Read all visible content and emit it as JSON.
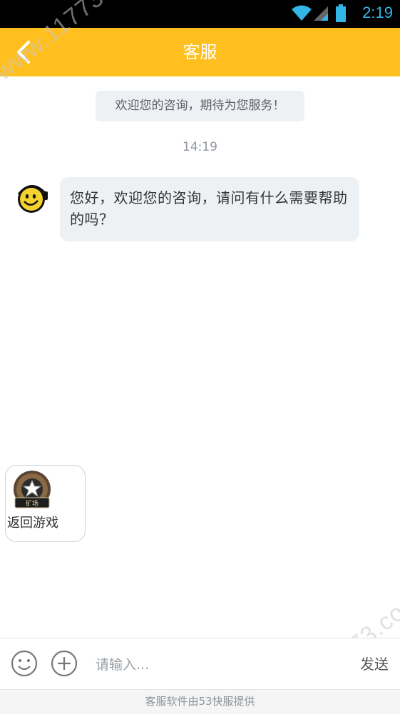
{
  "status_bar": {
    "time": "2:19"
  },
  "header": {
    "title": "客服"
  },
  "watermark": {
    "text": "www.11773.com"
  },
  "chat": {
    "welcome": "欢迎您的咨询，期待为您服务！",
    "timestamp": "14:19",
    "agent_message": "您好，欢迎您的咨询，请问有什么需要帮助的吗？"
  },
  "float_button": {
    "label": "返回游戏",
    "icon_caption": "矿场"
  },
  "input_bar": {
    "placeholder": "请输入...",
    "send_label": "发送"
  },
  "footer": {
    "text": "客服软件由53快服提供"
  },
  "colors": {
    "accent": "#ffbf1f",
    "statusbar": "#000000",
    "bubble": "#eef1f4"
  }
}
